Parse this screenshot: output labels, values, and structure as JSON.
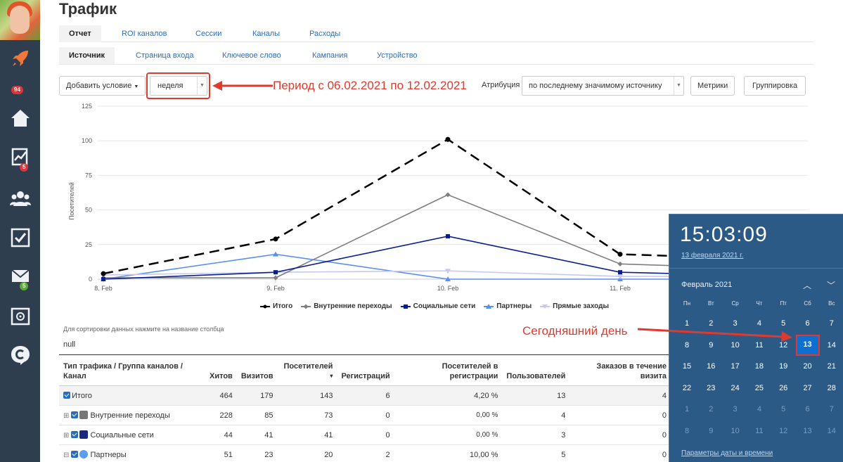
{
  "page": {
    "title": "Трафик"
  },
  "sidebar": {
    "badges": {
      "rocket": "94",
      "analytics": "5",
      "mail": "5"
    }
  },
  "tabs_main": [
    {
      "label": "Отчет",
      "active": true
    },
    {
      "label": "ROI каналов"
    },
    {
      "label": "Сессии"
    },
    {
      "label": "Каналы"
    },
    {
      "label": "Расходы"
    }
  ],
  "tabs_sub": [
    {
      "label": "Источник",
      "active": true
    },
    {
      "label": "Страница входа"
    },
    {
      "label": "Ключевое слово"
    },
    {
      "label": "Кампания"
    },
    {
      "label": "Устройство"
    }
  ],
  "toolbar": {
    "add_condition": "Добавить условие",
    "period_value": "неделя",
    "period_annotation": "Период с 06.02.2021 по 12.02.2021",
    "attribution_label": "Атрибуция",
    "attribution_value": "по последнему значимому источнику",
    "metrics": "Метрики",
    "grouping": "Группировка"
  },
  "chart_data": {
    "type": "line",
    "ylabel": "Посетителей",
    "ylim": [
      0,
      125
    ],
    "yticks": [
      0,
      25,
      50,
      75,
      100,
      125
    ],
    "x": [
      "8. Feb",
      "9. Feb",
      "10. Feb",
      "11. Feb"
    ],
    "series": [
      {
        "name": "Итого",
        "color": "#000000",
        "dash": true,
        "values": [
          4,
          29,
          101,
          18,
          14
        ]
      },
      {
        "name": "Внутренние переходы",
        "color": "#7f7f7f",
        "values": [
          1,
          1,
          61,
          11,
          7
        ]
      },
      {
        "name": "Социальные сети",
        "color": "#0a1f8f",
        "values": [
          0,
          5,
          31,
          5,
          2
        ]
      },
      {
        "name": "Партнеры",
        "color": "#5b8ff0",
        "values": [
          0,
          18,
          0,
          0,
          0
        ]
      },
      {
        "name": "Прямые заходы",
        "color": "#c8c8f2",
        "values": [
          3,
          5,
          6,
          2,
          2
        ]
      }
    ]
  },
  "table": {
    "hint": "Для сортировки данных нажмите на название столбца",
    "null_text": "null",
    "headers": {
      "type": "Тип трафика / Группа каналов / Канал",
      "hits": "Хитов",
      "visits": "Визитов",
      "visitors": "Посетителей",
      "sort_arrow": "▾",
      "registrations": "Регистраций",
      "visitors_reg": "Посетителей в регистрации",
      "users": "Пользователей",
      "orders": "Заказов в течение визита"
    },
    "rows": [
      {
        "name": "Итого",
        "hits": "464",
        "visits": "179",
        "visitors": "143",
        "reg": "6",
        "conv": "4,20 %",
        "users": "13",
        "orders": "4"
      },
      {
        "name": "Внутренние переходы",
        "hits": "228",
        "visits": "85",
        "visitors": "73",
        "reg": "0",
        "conv": "0,00 %",
        "users": "4",
        "orders": "0"
      },
      {
        "name": "Социальные сети",
        "hits": "44",
        "visits": "41",
        "visitors": "41",
        "reg": "0",
        "conv": "0,00 %",
        "users": "3",
        "orders": "0"
      },
      {
        "name": "Партнеры",
        "hits": "51",
        "visits": "23",
        "visitors": "20",
        "reg": "2",
        "conv": "10,00 %",
        "users": "5",
        "orders": "0"
      }
    ],
    "expand_plus": "⊞",
    "expand_minus": "⊟"
  },
  "calendar": {
    "time": "15:03:09",
    "date_link": "13 февраля 2021 г.",
    "month": "Февраль 2021",
    "weekdays": [
      "Пн",
      "Вт",
      "Ср",
      "Чт",
      "Пт",
      "Сб",
      "Вс"
    ],
    "weeks": [
      [
        "1",
        "2",
        "3",
        "4",
        "5",
        "6",
        "7"
      ],
      [
        "8",
        "9",
        "10",
        "11",
        "12",
        "13",
        "14"
      ],
      [
        "15",
        "16",
        "17",
        "18",
        "19",
        "20",
        "21"
      ],
      [
        "22",
        "23",
        "24",
        "25",
        "26",
        "27",
        "28"
      ],
      [
        "1",
        "2",
        "3",
        "4",
        "5",
        "6",
        "7"
      ],
      [
        "8",
        "9",
        "10",
        "11",
        "12",
        "13",
        "14"
      ]
    ],
    "today": "13",
    "today_annotation": "Сегодняшний день",
    "settings_link": "Параметры даты и времени",
    "nav_up": "︿",
    "nav_down": "﹀"
  }
}
